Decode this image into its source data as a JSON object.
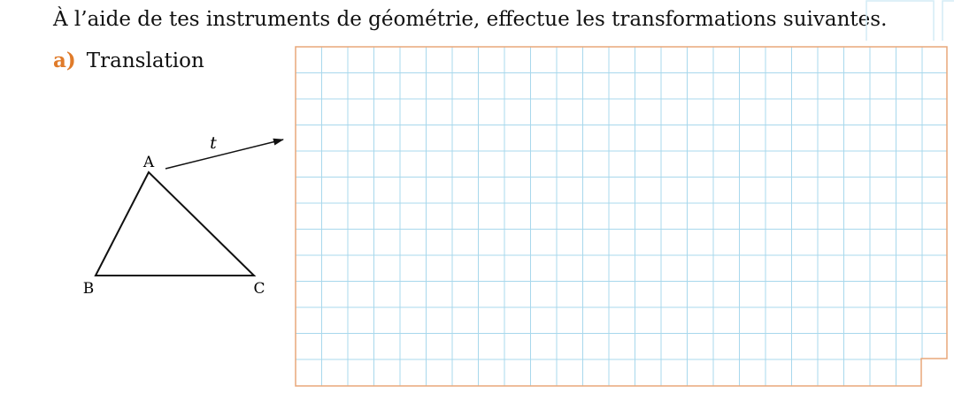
{
  "exercise": {
    "instruction": "À l’aide de tes instruments de géométrie, effectue les transformations suivantes.",
    "part_letter": "a)",
    "part_title": "Translation"
  },
  "figure": {
    "vector_label": "t",
    "vertex_a": "A",
    "vertex_b": "B",
    "vertex_c": "C"
  },
  "colors": {
    "accent": "#e07b2a",
    "grid_line": "#a8d8ec",
    "grid_border": "#e8a77a",
    "ink": "#111111"
  }
}
